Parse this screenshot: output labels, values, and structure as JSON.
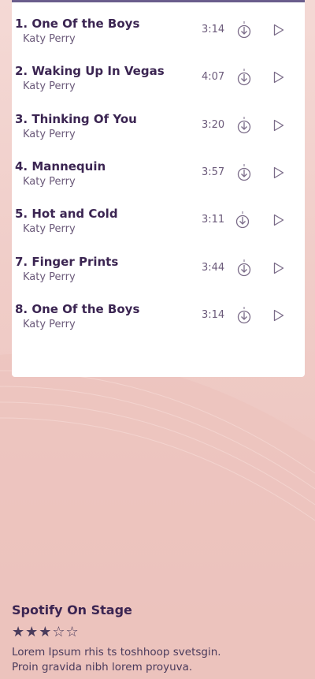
{
  "tracks": [
    {
      "title": "1. One Of the Boys",
      "artist": "Katy Perry",
      "duration": "3:14"
    },
    {
      "title": "2. Waking Up In Vegas",
      "artist": "Katy Perry",
      "duration": "4:07"
    },
    {
      "title": "3. Thinking Of You",
      "artist": "Katy Perry",
      "duration": "3:20"
    },
    {
      "title": "4. Mannequin",
      "artist": "Katy Perry",
      "duration": "3:57"
    },
    {
      "title": "5. Hot and Cold",
      "artist": "Katy Perry",
      "duration": "3:11"
    },
    {
      "title": "7. Finger Prints",
      "artist": "Katy Perry",
      "duration": "3:44"
    },
    {
      "title": "8. One Of the Boys",
      "artist": "Katy Perry",
      "duration": "3:14"
    }
  ],
  "footer": {
    "title": "Spotify On Stage",
    "rating": 3,
    "rating_max": 5,
    "stars_text": "★★★☆☆",
    "description_line1": "Lorem Ipsum rhis ts toshhoop svetsgin.",
    "description_line2": "Proin gravida nibh lorem proyuva."
  },
  "colors": {
    "accent": "#3b2552",
    "card_border": "#6a5d8c",
    "background": "#f0cdc8"
  }
}
